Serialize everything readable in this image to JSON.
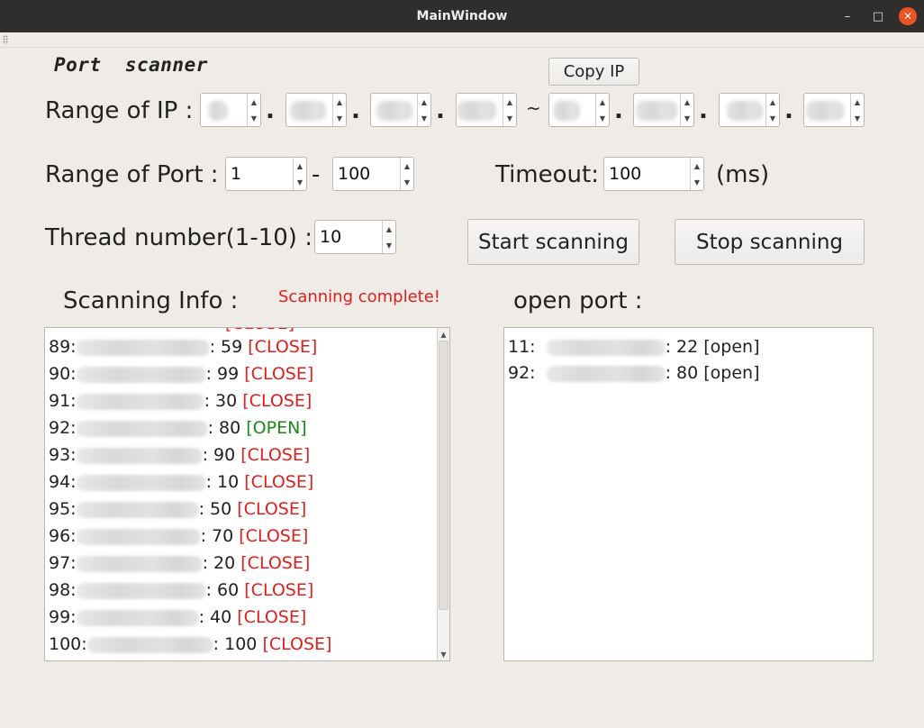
{
  "window": {
    "title": "MainWindow",
    "controls": {
      "minimize": "–",
      "maximize": "□",
      "close": "✕"
    }
  },
  "app_title": "Port  scanner",
  "buttons": {
    "copy_ip": "Copy IP",
    "start": "Start scanning",
    "stop": "Stop scanning"
  },
  "labels": {
    "range_ip": "Range of IP :",
    "range_port": "Range of Port :",
    "port_sep": "-",
    "ip_sep": "~",
    "dot": ".",
    "timeout": "Timeout:",
    "timeout_unit": "(ms)",
    "thread": "Thread number(1-10) :",
    "scanning_info": "Scanning Info :",
    "open_port": "open port :"
  },
  "status": {
    "text": "Scanning complete!",
    "color": "#e0201c"
  },
  "inputs": {
    "port_from": "1",
    "port_to": "100",
    "timeout": "100",
    "threads": "10"
  },
  "spin_arrows": {
    "up": "▲",
    "down": "▼"
  },
  "scan_log": [
    {
      "index": "89:",
      "port": "59",
      "status": "[CLOSE]",
      "state": "close"
    },
    {
      "index": "90:",
      "port": "99",
      "status": "[CLOSE]",
      "state": "close"
    },
    {
      "index": "91:",
      "port": "30",
      "status": "[CLOSE]",
      "state": "close"
    },
    {
      "index": "92:",
      "port": "80",
      "status": "[OPEN]",
      "state": "open"
    },
    {
      "index": "93:",
      "port": "90",
      "status": "[CLOSE]",
      "state": "close"
    },
    {
      "index": "94:",
      "port": "10",
      "status": "[CLOSE]",
      "state": "close"
    },
    {
      "index": "95:",
      "port": "50",
      "status": "[CLOSE]",
      "state": "close"
    },
    {
      "index": "96:",
      "port": "70",
      "status": "[CLOSE]",
      "state": "close"
    },
    {
      "index": "97:",
      "port": "20",
      "status": "[CLOSE]",
      "state": "close"
    },
    {
      "index": "98:",
      "port": "60",
      "status": "[CLOSE]",
      "state": "close"
    },
    {
      "index": "99:",
      "port": "40",
      "status": "[CLOSE]",
      "state": "close"
    },
    {
      "index": "100:",
      "port": "100",
      "status": "[CLOSE]",
      "state": "close"
    }
  ],
  "open_ports": [
    {
      "index": "11:",
      "port": "22",
      "status": "[open]"
    },
    {
      "index": "92:",
      "port": "80",
      "status": "[open]"
    }
  ],
  "colors": {
    "close": "#e0201c",
    "open": "#1a8a1a",
    "titlebar": "#2f2e2c",
    "window_bg": "#efebe7",
    "close_button": "#e95420"
  }
}
